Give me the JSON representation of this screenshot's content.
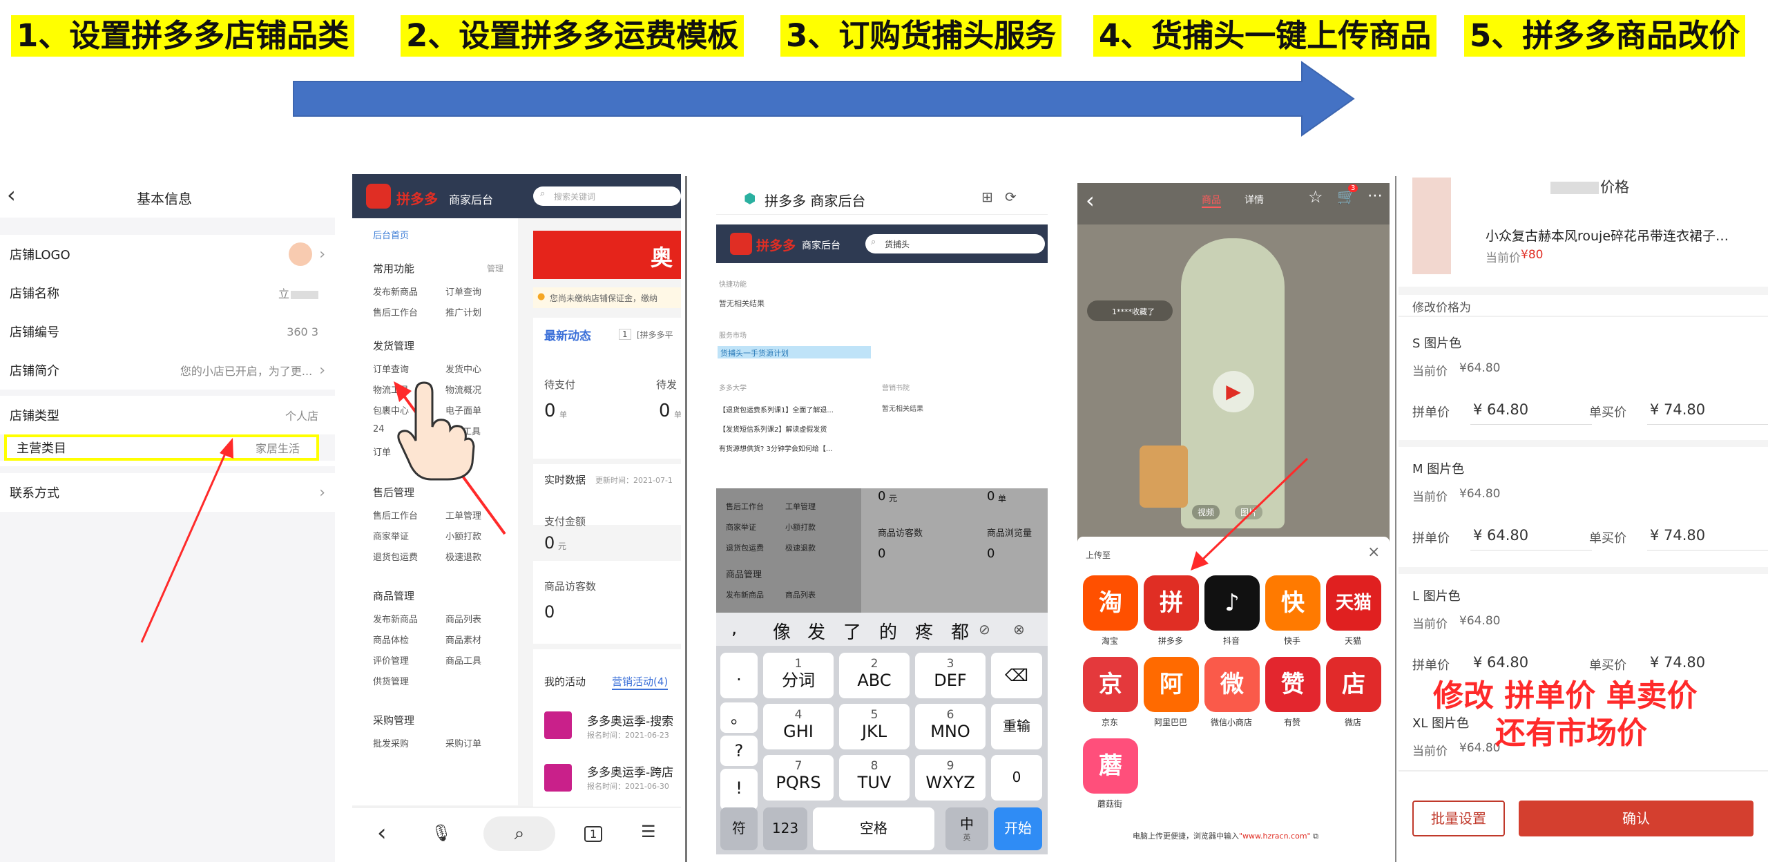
{
  "steps": [
    "1、设置拼多多店铺品类",
    "2、设置拼多多运费模板",
    "3、订购货捕头服务",
    "4、货捕头一键上传商品",
    "5、拼多多商品改价"
  ],
  "colors": {
    "highlight": "#ffff00",
    "arrow": "#4472c4",
    "pdd_red": "#e02e24",
    "annotation_red": "#ff2a2a"
  },
  "panel1": {
    "back_icon": "chevron-left-icon",
    "title": "基本信息",
    "rows": [
      {
        "label": "店铺LOGO",
        "value": ""
      },
      {
        "label": "店铺名称",
        "value": "立"
      },
      {
        "label": "店铺编号",
        "value": "360 3"
      },
      {
        "label": "店铺简介",
        "value": "您的小店已开启，为了更..."
      },
      {
        "label": "店铺类型",
        "value": "个人店"
      },
      {
        "label": "主营类目",
        "value": "家居生活"
      },
      {
        "label": "联系方式",
        "value": ""
      }
    ]
  },
  "panel2": {
    "logo": "拼多多",
    "subtitle": "商家后台",
    "search_placeholder": "搜索关键词",
    "breadcrumb": "后台首页",
    "common": {
      "title": "常用功能",
      "manage": "管理",
      "items": [
        "发布新商品",
        "订单查询",
        "售后工作台",
        "推广计划"
      ]
    },
    "shipping": {
      "title": "发货管理",
      "items": [
        "订单查询",
        "发货中心",
        "物流工具",
        "物流概况",
        "包裹中心",
        "电子面单",
        "24",
        "工具",
        "订单"
      ]
    },
    "after": {
      "title": "售后管理",
      "items": [
        "售后工作台",
        "工单管理",
        "商家举证",
        "小额打款",
        "退货包运费",
        "极速退款"
      ]
    },
    "goods": {
      "title": "商品管理",
      "items": [
        "发布新商品",
        "商品列表",
        "商品体检",
        "商品素材",
        "评价管理",
        "商品工具",
        "供货管理"
      ]
    },
    "purchase": {
      "title": "采购管理",
      "items": [
        "批发采购",
        "采购订单"
      ]
    },
    "banner": "奥",
    "notice": "您尚未缴纳店铺保证金，缴纳",
    "news_title": "最新动态",
    "news_badge": "1",
    "news_text": "[拼多多平",
    "pay_label": "待支付",
    "pay_value": "0",
    "pay_unit": "单",
    "pay2_label": "待发",
    "pay2_value": "0",
    "pay2_unit": "单",
    "realtime": "实时数据",
    "realtime_time": "更新时间：2021-07-1",
    "amount_label": "支付金额",
    "amount_value": "0",
    "amount_unit": "元",
    "visitor_label": "商品访客数",
    "visitor_value": "0",
    "activity_tabs": [
      "我的活动",
      "营销活动(4)"
    ],
    "activities": [
      {
        "name": "多多奥运季-搜索",
        "time": "报名时间：2021-06-23"
      },
      {
        "name": "多多奥运季-跨店",
        "time": "报名时间：2021-06-30"
      }
    ]
  },
  "panel3": {
    "title": "拼多多 商家后台",
    "logo": "拼多多",
    "subtitle": "商家后台",
    "search_value": "货捕头",
    "section1": "快捷功能",
    "section1_empty": "暂无相关结果",
    "section2": "服务市场",
    "highlight": "货捕头一手货源计划",
    "section3": "多多大学",
    "section4": "营销书院",
    "section4_empty": "暂无相关结果",
    "courses": [
      "【退货包运费系列课1】全面了解退...",
      "【发货短信系列课2】解读虚假发货",
      "有货源想供货? 3分钟学会如何给【..."
    ],
    "dim_menu": [
      "售后工作台",
      "工单管理",
      "商家举证",
      "小额打款",
      "退货包运费",
      "极速退款",
      "商品管理",
      "发布新商品",
      "商品列表"
    ],
    "dim_stats": [
      "0",
      "元",
      "0",
      "单",
      "商品访客数",
      "商品浏览量",
      "0",
      "0"
    ],
    "candidates": [
      ",",
      "像",
      "发",
      "了",
      "的",
      "疼",
      "都"
    ],
    "keys": [
      {
        "n": "1",
        "l": "分词"
      },
      {
        "n": "2",
        "l": "ABC"
      },
      {
        "n": "3",
        "l": "DEF"
      },
      {
        "n": "4",
        "l": "GHI"
      },
      {
        "n": "5",
        "l": "JKL"
      },
      {
        "n": "6",
        "l": "MNO"
      },
      {
        "n": "7",
        "l": "PQRS"
      },
      {
        "n": "8",
        "l": "TUV"
      },
      {
        "n": "9",
        "l": "WXYZ"
      }
    ],
    "side_keys": [
      ".",
      "。",
      "?",
      "!"
    ],
    "right_keys": [
      "重输",
      "0"
    ],
    "bottom_keys": [
      "符",
      "123",
      "空格",
      "中",
      "开始"
    ],
    "bottom_sub": "英"
  },
  "panel4": {
    "tabs": [
      "商品",
      "详情"
    ],
    "cart_badge": "3",
    "viewer": "1****收藏了",
    "video": "视频",
    "image": "图片",
    "share_title": "上传至",
    "apps": [
      {
        "name": "淘宝",
        "glyph": "淘",
        "color": "#ff5000"
      },
      {
        "name": "拼多多",
        "glyph": "拼",
        "color": "#e02e24"
      },
      {
        "name": "抖音",
        "glyph": "♪",
        "color": "#111111"
      },
      {
        "name": "快手",
        "glyph": "快",
        "color": "#ff7a00"
      },
      {
        "name": "天猫",
        "glyph": "天猫",
        "color": "#e02020"
      },
      {
        "name": "京东",
        "glyph": "京",
        "color": "#e4393c"
      },
      {
        "name": "阿里巴巴",
        "glyph": "阿",
        "color": "#ff6a00"
      },
      {
        "name": "微信小商店",
        "glyph": "微",
        "color": "#fa5a4a"
      },
      {
        "name": "有赞",
        "glyph": "赞",
        "color": "#e3262e"
      },
      {
        "name": "微店",
        "glyph": "店",
        "color": "#e12a2a"
      },
      {
        "name": "蘑菇街",
        "glyph": "蘑",
        "color": "#ff4f7b"
      }
    ],
    "footer": "电脑上传更便捷，浏览器中输入",
    "footer_url": "\"www.hzracn.com\""
  },
  "panel5": {
    "header": "价格",
    "product_name": "小众复古赫本风rouje碎花吊带连衣裙子…",
    "current_price_label": "当前价",
    "current_price": "¥80",
    "modify_label": "修改价格为",
    "variants": [
      {
        "name": "S 图片色",
        "current": "¥64.80",
        "group": "¥ 64.80",
        "single": "¥ 74.80"
      },
      {
        "name": "M 图片色",
        "current": "¥64.80",
        "group": "¥ 64.80",
        "single": "¥ 74.80"
      },
      {
        "name": "L 图片色",
        "current": "¥64.80",
        "group": "¥ 64.80",
        "single": "¥ 74.80"
      },
      {
        "name": "XL 图片色",
        "current": "¥64.80",
        "group": "",
        "single": ""
      }
    ],
    "current_label": "当前价",
    "group_label": "拼单价",
    "single_label": "单买价",
    "annotation_line1": "修改 拼单价 单卖价",
    "annotation_line2": "还有市场价",
    "batch_button": "批量设置",
    "confirm_button": "确认"
  }
}
